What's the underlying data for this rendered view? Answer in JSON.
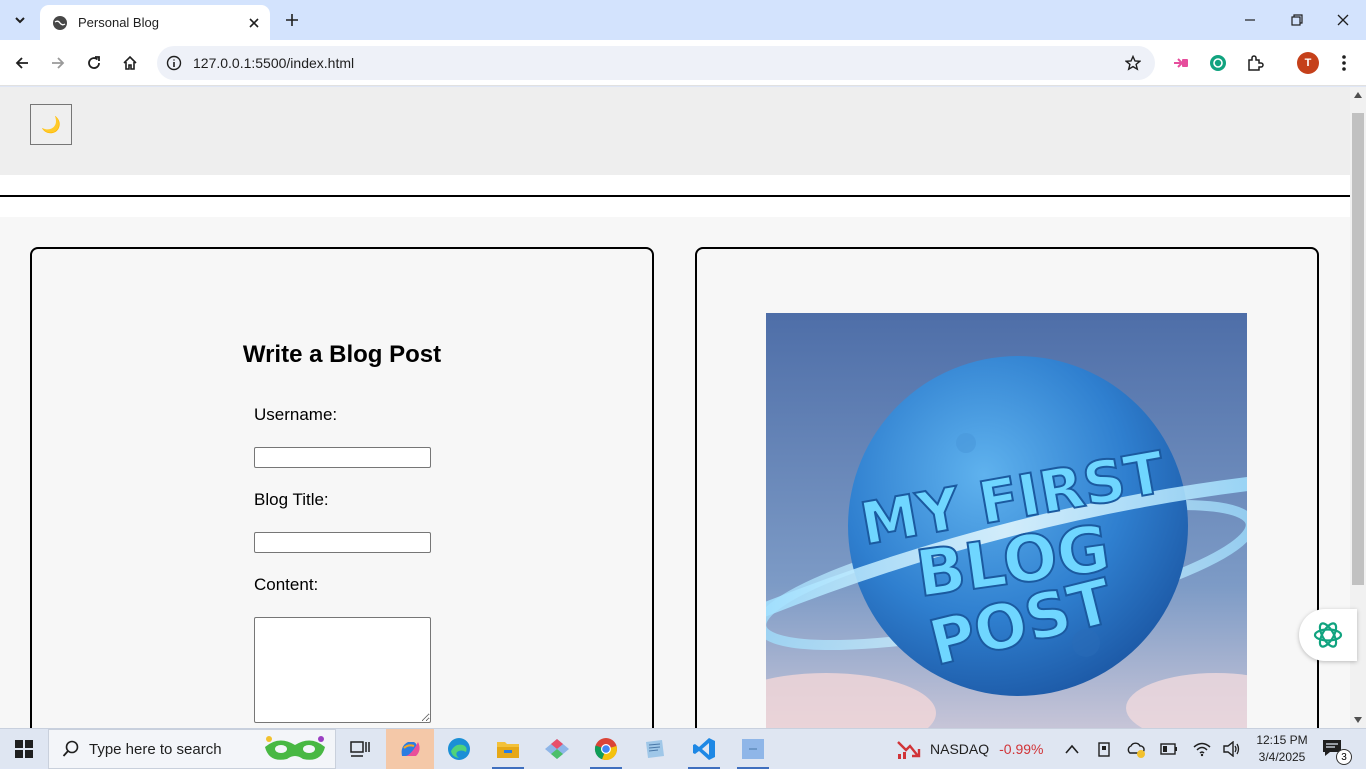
{
  "browser": {
    "tab_title": "Personal Blog",
    "url": "127.0.0.1:5500/index.html",
    "profile_initial": "T"
  },
  "page": {
    "theme_toggle_icon": "🌙",
    "form": {
      "title": "Write a Blog Post",
      "username_label": "Username:",
      "username_value": "",
      "blog_title_label": "Blog Title:",
      "blog_title_value": "",
      "content_label": "Content:",
      "content_value": ""
    },
    "hero_image": {
      "line1": "MY FIRST",
      "line2": "BLOG",
      "line3": "POST"
    }
  },
  "taskbar": {
    "search_placeholder": "Type here to search",
    "stock_name": "NASDAQ",
    "stock_change": "-0.99%",
    "time": "12:15 PM",
    "date": "3/4/2025",
    "notification_count": "3"
  },
  "colors": {
    "tabbar": "#d3e3fd",
    "stock_negative": "#d13438",
    "profile": "#c5401a"
  }
}
